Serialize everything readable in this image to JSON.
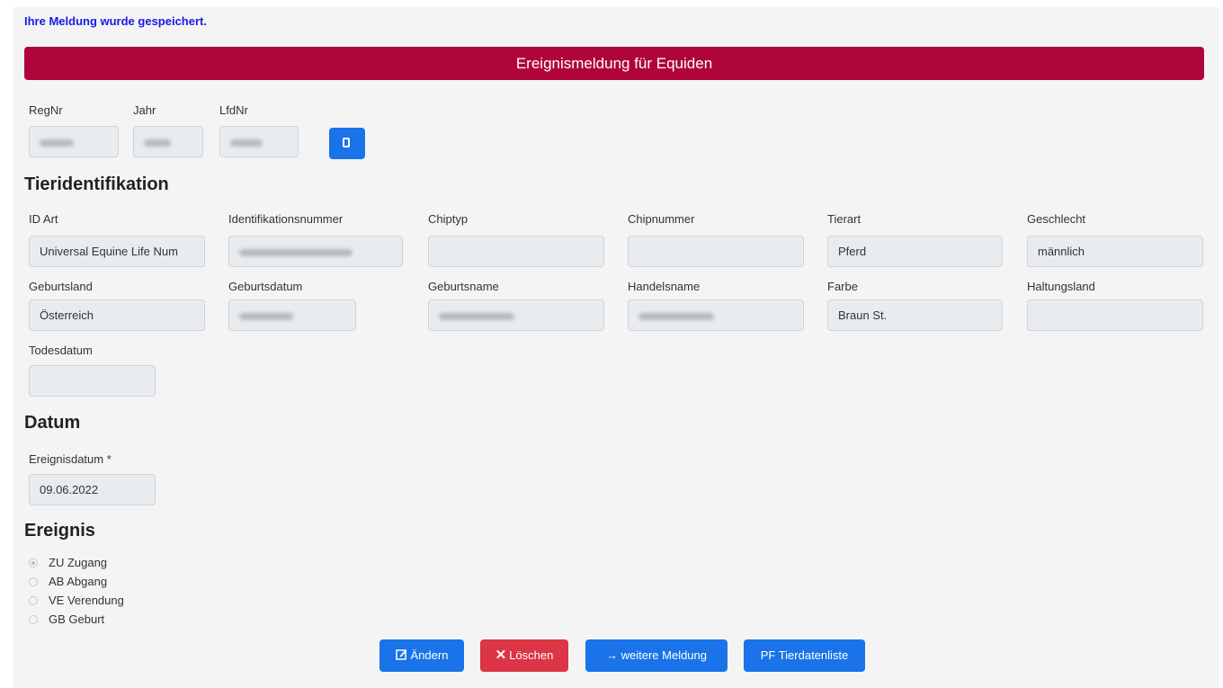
{
  "status_message": "Ihre Meldung wurde gespeichert.",
  "banner_title": "Ereignismeldung für Equiden",
  "registration": {
    "regnr_label": "RegNr",
    "jahr_label": "Jahr",
    "lfdnr_label": "LfdNr",
    "copy_icon": "copy-icon"
  },
  "tieridentifikation": {
    "heading": "Tieridentifikation",
    "id_art_label": "ID Art",
    "id_art_value": "Universal Equine Life Num",
    "identifikationsnummer_label": "Identifikationsnummer",
    "chiptyp_label": "Chiptyp",
    "chipnummer_label": "Chipnummer",
    "tierart_label": "Tierart",
    "tierart_value": "Pferd",
    "geschlecht_label": "Geschlecht",
    "geschlecht_value": "männlich",
    "geburtsland_label": "Geburtsland",
    "geburtsland_value": "Österreich",
    "geburtsdatum_label": "Geburtsdatum",
    "geburtsname_label": "Geburtsname",
    "handelsname_label": "Handelsname",
    "farbe_label": "Farbe",
    "farbe_value": "Braun St.",
    "haltungsland_label": "Haltungsland",
    "todesdatum_label": "Todesdatum"
  },
  "datum": {
    "heading": "Datum",
    "ereignisdatum_label": "Ereignisdatum *",
    "ereignisdatum_value": "09.06.2022"
  },
  "ereignis": {
    "heading": "Ereignis",
    "options": [
      "ZU Zugang",
      "AB Abgang",
      "VE Verendung",
      "GB Geburt"
    ],
    "selected": "ZU Zugang"
  },
  "actions": {
    "aendern": "Ändern",
    "loeschen": "Löschen",
    "weitere": "→ weitere Meldung",
    "tierdatenliste": "PF Tierdatenliste"
  },
  "colors": {
    "banner": "#b0053a",
    "primary": "#1a73e8",
    "danger": "#dc3545",
    "status_text": "#1a1ae6"
  }
}
